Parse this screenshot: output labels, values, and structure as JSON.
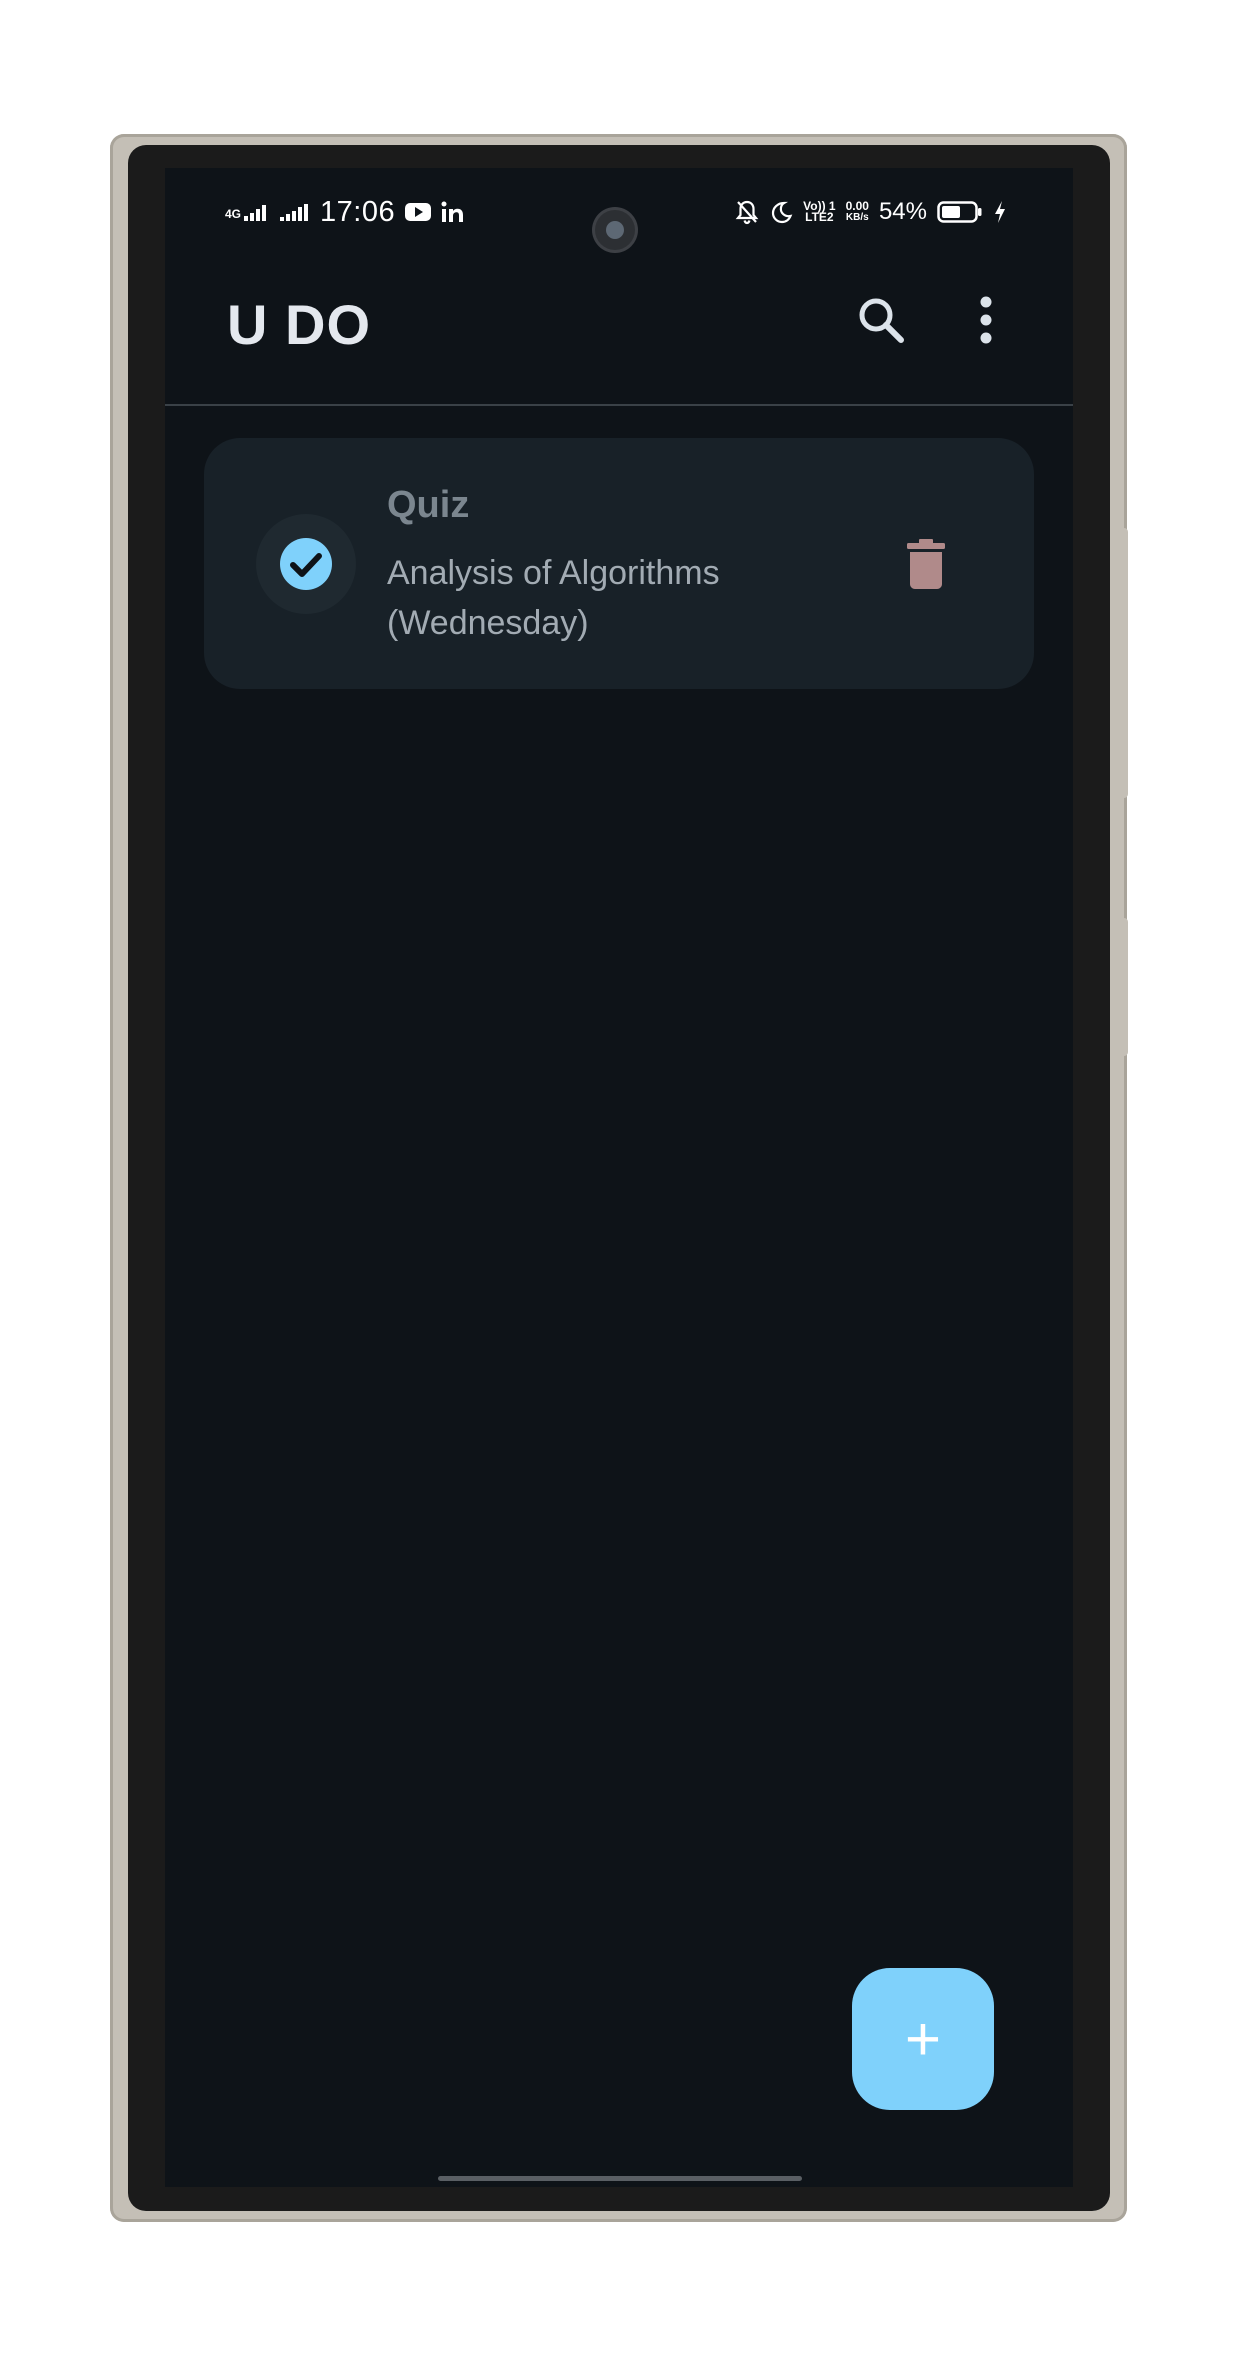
{
  "status_bar": {
    "network_type": "4G",
    "time": "17:06",
    "volte_line1": "Vo)) 1",
    "volte_line2": "LTE2",
    "speed_value": "0.00",
    "speed_unit": "KB/s",
    "battery": "54%",
    "icons": [
      "signal-icon",
      "youtube-icon",
      "linkedin-icon",
      "bell-off-icon",
      "moon-icon",
      "battery-icon",
      "charging-icon"
    ]
  },
  "app_bar": {
    "title": "U DO",
    "icons": [
      "search-icon",
      "more-vert-icon"
    ]
  },
  "tasks": [
    {
      "title": "Quiz",
      "description": "Analysis of Algorithms (Wednesday)",
      "completed": true
    }
  ],
  "fab": {
    "label": "+"
  },
  "colors": {
    "background": "#0e1318",
    "card": "#182128",
    "accent": "#7fd1fb",
    "delete": "#b08a8a",
    "title_text": "#e4e8ee"
  }
}
